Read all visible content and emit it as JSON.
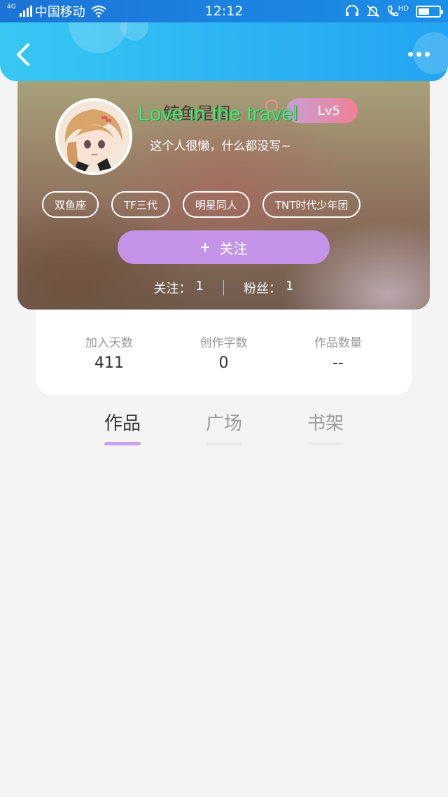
{
  "status_bar": {
    "network": "4G",
    "carrier": "中国移动",
    "time": "12:12",
    "hd_label": "HD",
    "battery_level": 0.55
  },
  "header": {
    "back_icon": "chevron-left-icon",
    "more_icon": "more-horizontal-icon"
  },
  "profile": {
    "username": "鲸鱼是個",
    "overlay_text": "Love in the travel",
    "level": "Lv5",
    "bio": "这个人很懒，什么都没写~",
    "tags": [
      "双鱼座",
      "TF三代",
      "明星同人",
      "TNT时代少年团"
    ],
    "follow_label": "关注",
    "follow_icon": "plus-icon",
    "following_label": "关注：",
    "following_count": "1",
    "fans_label": "粉丝：",
    "fans_count": "1"
  },
  "stats": [
    {
      "label": "加入天数",
      "value": "411"
    },
    {
      "label": "创作字数",
      "value": "0"
    },
    {
      "label": "作品数量",
      "value": "--"
    }
  ],
  "tabs": [
    {
      "label": "作品",
      "active": true
    },
    {
      "label": "广场",
      "active": false
    },
    {
      "label": "书架",
      "active": false
    }
  ],
  "colors": {
    "header": "#2bb3f3",
    "follow_button": "#c394e8",
    "active_tab_underline": "#c8a3ec",
    "level_badge_start": "#c7a0d6",
    "level_badge_end": "#f17f94"
  }
}
